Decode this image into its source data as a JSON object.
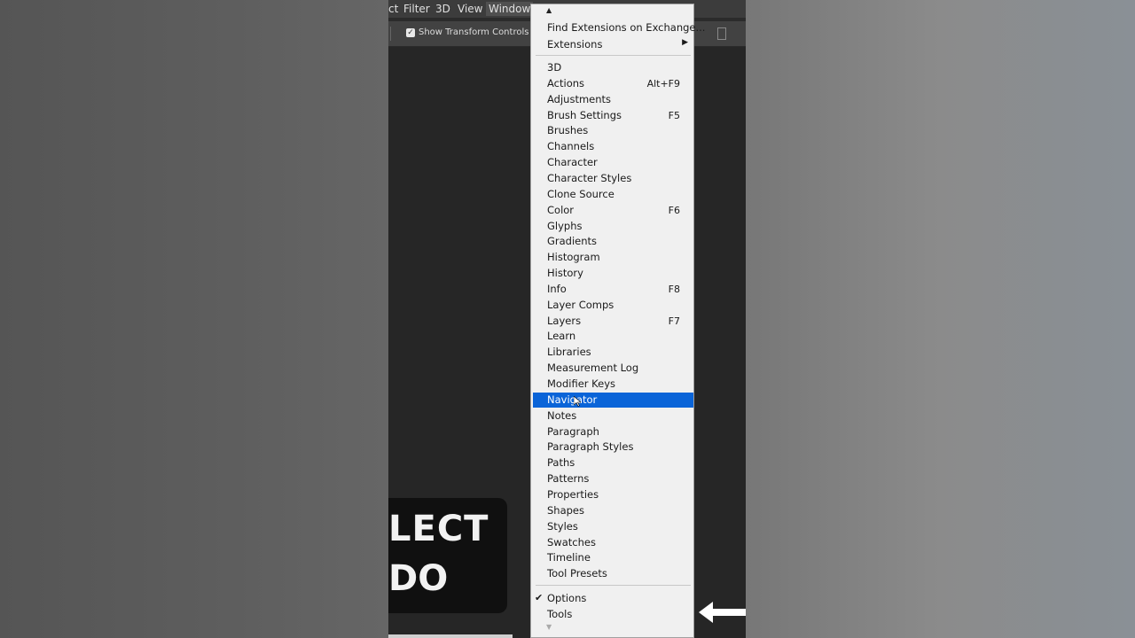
{
  "menubar": {
    "items": [
      "ct",
      "Filter",
      "3D",
      "View",
      "Window"
    ]
  },
  "options_bar": {
    "show_transform_controls": "Show Transform Controls",
    "checked": true
  },
  "banner": {
    "line1": "LECT",
    "line2": "DO"
  },
  "dropdown": {
    "top_items": [
      {
        "label": "Find Extensions on Exchange..."
      },
      {
        "label": "Extensions",
        "submenu": true
      }
    ],
    "panel_items": [
      {
        "label": "3D",
        "shortcut": ""
      },
      {
        "label": "Actions",
        "shortcut": "Alt+F9"
      },
      {
        "label": "Adjustments",
        "shortcut": ""
      },
      {
        "label": "Brush Settings",
        "shortcut": "F5"
      },
      {
        "label": "Brushes",
        "shortcut": ""
      },
      {
        "label": "Channels",
        "shortcut": ""
      },
      {
        "label": "Character",
        "shortcut": ""
      },
      {
        "label": "Character Styles",
        "shortcut": ""
      },
      {
        "label": "Clone Source",
        "shortcut": ""
      },
      {
        "label": "Color",
        "shortcut": "F6"
      },
      {
        "label": "Glyphs",
        "shortcut": ""
      },
      {
        "label": "Gradients",
        "shortcut": ""
      },
      {
        "label": "Histogram",
        "shortcut": ""
      },
      {
        "label": "History",
        "shortcut": ""
      },
      {
        "label": "Info",
        "shortcut": "F8"
      },
      {
        "label": "Layer Comps",
        "shortcut": ""
      },
      {
        "label": "Layers",
        "shortcut": "F7"
      },
      {
        "label": "Learn",
        "shortcut": ""
      },
      {
        "label": "Libraries",
        "shortcut": ""
      },
      {
        "label": "Measurement Log",
        "shortcut": ""
      },
      {
        "label": "Modifier Keys",
        "shortcut": ""
      },
      {
        "label": "Navigator",
        "shortcut": "",
        "highlighted": true
      },
      {
        "label": "Notes",
        "shortcut": ""
      },
      {
        "label": "Paragraph",
        "shortcut": ""
      },
      {
        "label": "Paragraph Styles",
        "shortcut": ""
      },
      {
        "label": "Paths",
        "shortcut": ""
      },
      {
        "label": "Patterns",
        "shortcut": ""
      },
      {
        "label": "Properties",
        "shortcut": ""
      },
      {
        "label": "Shapes",
        "shortcut": ""
      },
      {
        "label": "Styles",
        "shortcut": ""
      },
      {
        "label": "Swatches",
        "shortcut": ""
      },
      {
        "label": "Timeline",
        "shortcut": ""
      },
      {
        "label": "Tool Presets",
        "shortcut": ""
      }
    ],
    "bottom_items": [
      {
        "label": "Options",
        "checked": true
      },
      {
        "label": "Tools",
        "checked": false
      }
    ]
  },
  "colors": {
    "highlight": "#0a64d8",
    "menu_bg": "#f0f0f0",
    "app_bg": "#2b2b2b"
  }
}
